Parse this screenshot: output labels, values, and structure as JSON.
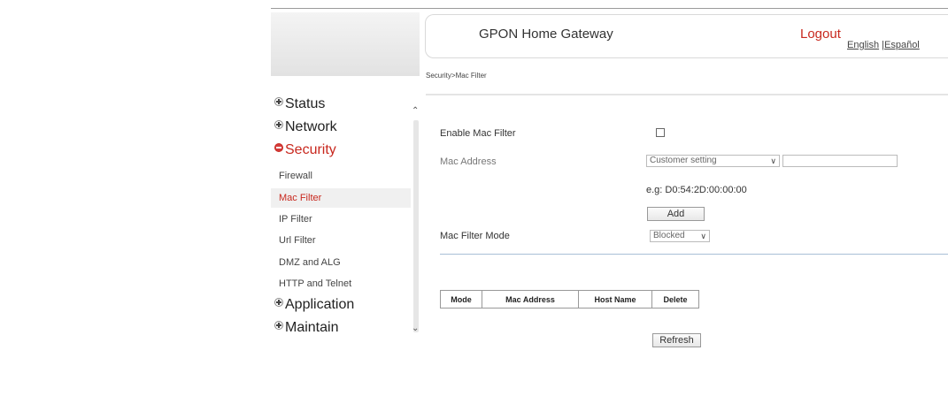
{
  "header": {
    "title": "GPON Home Gateway",
    "logout": "Logout",
    "lang_english": "English",
    "lang_sep": " |",
    "lang_spanish": "Español"
  },
  "breadcrumb": "Security>Mac Filter",
  "sidebar": {
    "status": "Status",
    "network": "Network",
    "security": "Security",
    "security_items": [
      "Firewall",
      "Mac Filter",
      "IP Filter",
      "Url Filter",
      "DMZ and ALG",
      "HTTP and Telnet"
    ],
    "selected_item": "Mac Filter",
    "application": "Application",
    "maintain": "Maintain"
  },
  "form": {
    "enable_label": "Enable Mac Filter",
    "enable_checked": false,
    "mac_label": "Mac Address",
    "mac_select": "Customer setting",
    "mac_value": "",
    "example": "e.g: D0:54:2D:00:00:00",
    "add": "Add",
    "mode_label": "Mac Filter Mode",
    "mode_select": "Blocked"
  },
  "table": {
    "headers": [
      "Mode",
      "Mac Address",
      "Host Name",
      "Delete"
    ]
  },
  "refresh": "Refresh",
  "colors": {
    "accent": "#c8281e",
    "divider": "#a9bfd6"
  }
}
